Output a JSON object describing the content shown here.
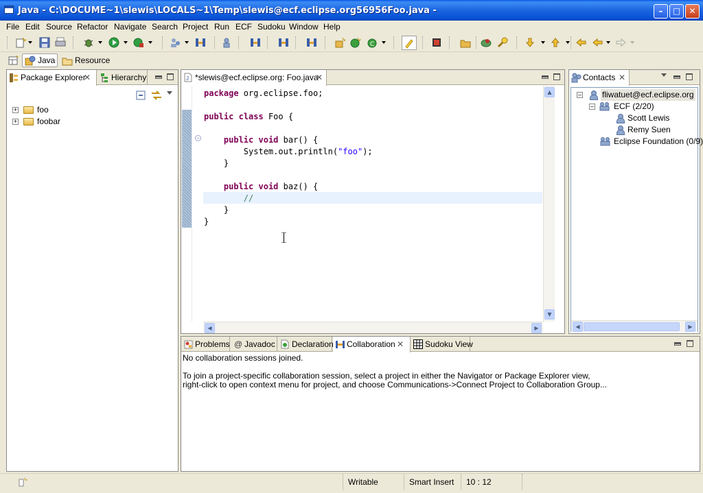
{
  "window": {
    "title": "Java - C:\\DOCUME~1\\slewis\\LOCALS~1\\Temp\\slewis@ecf.eclipse.org56956Foo.java -"
  },
  "menu": [
    "File",
    "Edit",
    "Source",
    "Refactor",
    "Navigate",
    "Search",
    "Project",
    "Run",
    "ECF",
    "Sudoku",
    "Window",
    "Help"
  ],
  "perspectives": {
    "java": "Java",
    "resource": "Resource"
  },
  "left_view": {
    "tabs": [
      "Package Explorer",
      "Hierarchy"
    ],
    "tree": [
      "foo",
      "foobar"
    ]
  },
  "editor": {
    "tab": "*slewis@ecf.eclipse.org: Foo.java",
    "lines": [
      [
        {
          "t": "package",
          "c": "kw"
        },
        {
          "t": " org.eclipse.foo;"
        }
      ],
      [],
      [
        {
          "t": "public",
          "c": "kw"
        },
        {
          "t": " "
        },
        {
          "t": "class",
          "c": "kw"
        },
        {
          "t": " Foo {"
        }
      ],
      [],
      [
        {
          "t": "    "
        },
        {
          "t": "public",
          "c": "kw"
        },
        {
          "t": " "
        },
        {
          "t": "void",
          "c": "kw"
        },
        {
          "t": " bar() {"
        }
      ],
      [
        {
          "t": "        System.out.println("
        },
        {
          "t": "\"foo\"",
          "c": "str"
        },
        {
          "t": ");"
        }
      ],
      [
        {
          "t": "    }"
        }
      ],
      [],
      [
        {
          "t": "    "
        },
        {
          "t": "public",
          "c": "kw"
        },
        {
          "t": " "
        },
        {
          "t": "void",
          "c": "kw"
        },
        {
          "t": " baz() {"
        }
      ],
      [
        {
          "t": "        "
        },
        {
          "t": "//",
          "c": "cmt"
        }
      ],
      [
        {
          "t": "    }"
        }
      ],
      [
        {
          "t": "}"
        }
      ]
    ]
  },
  "contacts": {
    "tab": "Contacts",
    "account": "fliwatuet@ecf.eclipse.org",
    "groups": [
      {
        "name": "ECF (2/20)",
        "members": [
          "Scott Lewis",
          "Remy Suen"
        ]
      },
      {
        "name": "Eclipse Foundation (0/9)",
        "members": []
      }
    ]
  },
  "bottom_view": {
    "tabs": [
      "Problems",
      "Javadoc",
      "Declaration",
      "Collaboration",
      "Sudoku View"
    ],
    "active_tab": "Collaboration",
    "message1": "No collaboration sessions joined.",
    "message2": "To join a project-specific collaboration session, select a project in either the Navigator or Package Explorer view,",
    "message3": "right-click to open context menu for project, and choose Communications->Connect Project to Collaboration Group..."
  },
  "status": {
    "mode": "Writable",
    "insert": "Smart Insert",
    "position": "10 : 12"
  }
}
